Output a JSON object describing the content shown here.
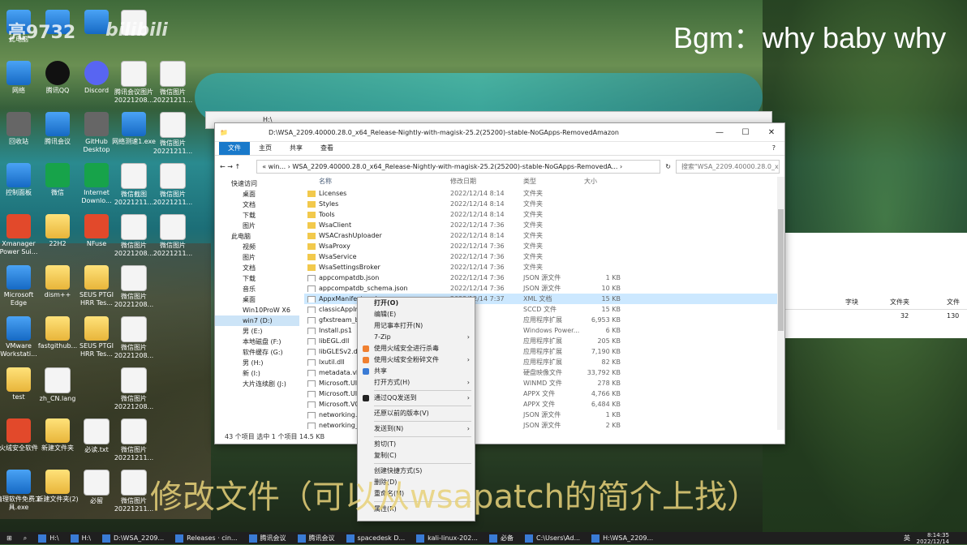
{
  "overlay": {
    "watermark": "亮9732",
    "bili": "bilibili",
    "bgm": "Bgm：why baby why",
    "subtitle": "修改文件（可以从wsapatch的简介上找）"
  },
  "desktop_icons": [
    {
      "label": "此电脑",
      "kind": "blue"
    },
    {
      "label": "",
      "kind": "blue"
    },
    {
      "label": "",
      "kind": "blue"
    },
    {
      "label": "",
      "kind": "doc"
    },
    {
      "label": "网络",
      "kind": "blue"
    },
    {
      "label": "腾讯QQ",
      "kind": "qq"
    },
    {
      "label": "Discord",
      "kind": "discord"
    },
    {
      "label": "腾讯会议图片20221208...",
      "kind": "doc"
    },
    {
      "label": "微信图片20221211...",
      "kind": "doc"
    },
    {
      "label": "回收站",
      "kind": "gray"
    },
    {
      "label": "腾讯会议",
      "kind": "blue"
    },
    {
      "label": "GitHub Desktop",
      "kind": "gray"
    },
    {
      "label": "网络测速1.exe",
      "kind": "blue"
    },
    {
      "label": "微信图片20221211...",
      "kind": "doc"
    },
    {
      "label": "控制面板",
      "kind": "blue"
    },
    {
      "label": "微信",
      "kind": "green"
    },
    {
      "label": "Internet Downlo...",
      "kind": "green"
    },
    {
      "label": "微信截图20221211...",
      "kind": "doc"
    },
    {
      "label": "微信图片20221211...",
      "kind": "doc"
    },
    {
      "label": "Xmanager Power Sui...",
      "kind": "red"
    },
    {
      "label": "22H2",
      "kind": "folder"
    },
    {
      "label": "NFuse",
      "kind": "red"
    },
    {
      "label": "微信图片20221208...",
      "kind": "doc"
    },
    {
      "label": "微信图片20221211...",
      "kind": "doc"
    },
    {
      "label": "Microsoft Edge",
      "kind": "blue"
    },
    {
      "label": "dism++",
      "kind": "folder"
    },
    {
      "label": "SEUS PTGI HRR Tes...",
      "kind": "folder"
    },
    {
      "label": "微信图片20221208...",
      "kind": "doc"
    },
    {
      "label": "VMware Workstati...",
      "kind": "blue"
    },
    {
      "label": "fastgithub...",
      "kind": "folder"
    },
    {
      "label": "SEUS PTGI HRR Tes...",
      "kind": "folder"
    },
    {
      "label": "微信图片20221208...",
      "kind": "doc"
    },
    {
      "label": "test",
      "kind": "folder"
    },
    {
      "label": "zh_CN.lang",
      "kind": "doc"
    },
    {
      "label": "微信图片20221208...",
      "kind": "doc"
    },
    {
      "label": "火绒安全软件",
      "kind": "red"
    },
    {
      "label": "新建文件夹",
      "kind": "folder"
    },
    {
      "label": "必读.txt",
      "kind": "doc"
    },
    {
      "label": "微信图片20221211...",
      "kind": "doc"
    },
    {
      "label": "清理软件免费工具.exe",
      "kind": "blue"
    },
    {
      "label": "新建文件夹(2)",
      "kind": "folder"
    },
    {
      "label": "必留",
      "kind": "doc"
    },
    {
      "label": "微信图片20221211...",
      "kind": "doc"
    }
  ],
  "back_window": {
    "title": "H:\\"
  },
  "right_panel": {
    "headers": [
      "字块",
      "文件夹",
      "文件"
    ],
    "values": [
      "",
      "32",
      "130"
    ]
  },
  "explorer": {
    "title": "D:\\WSA_2209.40000.28.0_x64_Release-Nightly-with-magisk-25.2(25200)-stable-NoGApps-RemovedAmazon",
    "ribbon": [
      "文件",
      "主页",
      "共享",
      "查看"
    ],
    "address": "« win... › WSA_2209.40000.28.0_x64_Release-Nightly-with-magisk-25.2(25200)-stable-NoGApps-RemovedA... ›",
    "search": "搜索\"WSA_2209.40000.28.0_x...",
    "nav": [
      {
        "label": "快速访问",
        "sec": true
      },
      {
        "label": "桌面"
      },
      {
        "label": "文档"
      },
      {
        "label": "下载"
      },
      {
        "label": "图片"
      },
      {
        "label": "此电脑",
        "sec": true
      },
      {
        "label": "视频"
      },
      {
        "label": "图片"
      },
      {
        "label": "文档"
      },
      {
        "label": "下载"
      },
      {
        "label": "音乐"
      },
      {
        "label": "桌面"
      },
      {
        "label": "Win10ProW X6"
      },
      {
        "label": "win7 (D:)",
        "sel": true
      },
      {
        "label": "男 (E:)"
      },
      {
        "label": "本地磁盘 (F:)"
      },
      {
        "label": "软件缓存 (G:)"
      },
      {
        "label": "男 (H:)"
      },
      {
        "label": "新 (I:)"
      },
      {
        "label": "大片连续剧 (J:)"
      }
    ],
    "columns": [
      "名称",
      "修改日期",
      "类型",
      "大小"
    ],
    "files": [
      {
        "name": "Licenses",
        "date": "2022/12/14 8:14",
        "type": "文件夹",
        "size": "",
        "folder": true
      },
      {
        "name": "Styles",
        "date": "2022/12/14 8:14",
        "type": "文件夹",
        "size": "",
        "folder": true
      },
      {
        "name": "Tools",
        "date": "2022/12/14 8:14",
        "type": "文件夹",
        "size": "",
        "folder": true
      },
      {
        "name": "WsaClient",
        "date": "2022/12/14 7:36",
        "type": "文件夹",
        "size": "",
        "folder": true
      },
      {
        "name": "WSACrashUploader",
        "date": "2022/12/14 8:14",
        "type": "文件夹",
        "size": "",
        "folder": true
      },
      {
        "name": "WsaProxy",
        "date": "2022/12/14 7:36",
        "type": "文件夹",
        "size": "",
        "folder": true
      },
      {
        "name": "WsaService",
        "date": "2022/12/14 7:36",
        "type": "文件夹",
        "size": "",
        "folder": true
      },
      {
        "name": "WsaSettingsBroker",
        "date": "2022/12/14 7:36",
        "type": "文件夹",
        "size": "",
        "folder": true
      },
      {
        "name": "appcompatdb.json",
        "date": "2022/12/14 7:36",
        "type": "JSON 源文件",
        "size": "1 KB"
      },
      {
        "name": "appcompatdb_schema.json",
        "date": "2022/12/14 7:36",
        "type": "JSON 源文件",
        "size": "10 KB"
      },
      {
        "name": "AppxManifest.xml",
        "date": "2022/12/14 7:37",
        "type": "XML 文档",
        "size": "15 KB",
        "sel": true
      },
      {
        "name": "classicAppIns",
        "date": "",
        "type": "SCCD 文件",
        "size": "15 KB"
      },
      {
        "name": "gfxstream_ba",
        "date": "",
        "type": "应用程序扩展",
        "size": "6,953 KB"
      },
      {
        "name": "Install.ps1",
        "date": "",
        "type": "Windows Power...",
        "size": "6 KB"
      },
      {
        "name": "libEGL.dll",
        "date": "",
        "type": "应用程序扩展",
        "size": "205 KB"
      },
      {
        "name": "libGLESv2.dll",
        "date": "",
        "type": "应用程序扩展",
        "size": "7,190 KB"
      },
      {
        "name": "lxutil.dll",
        "date": "",
        "type": "应用程序扩展",
        "size": "82 KB"
      },
      {
        "name": "metadata.vhc",
        "date": "",
        "type": "硬盘映像文件",
        "size": "33,792 KB"
      },
      {
        "name": "Microsoft.UI.",
        "date": "",
        "type": "WINMD 文件",
        "size": "278 KB"
      },
      {
        "name": "Microsoft.UI.",
        "date": "",
        "type": "APPX 文件",
        "size": "4,766 KB"
      },
      {
        "name": "Microsoft.VC",
        "date": "",
        "type": "APPX 文件",
        "size": "6,484 KB"
      },
      {
        "name": "networking.js",
        "date": "",
        "type": "JSON 源文件",
        "size": "1 KB"
      },
      {
        "name": "networking_s",
        "date": "",
        "type": "JSON 源文件",
        "size": "2 KB"
      }
    ],
    "status": "43 个项目    选中 1 个项目  14.5 KB"
  },
  "context_menu": [
    {
      "label": "打开(O)",
      "bold": true
    },
    {
      "label": "编辑(E)"
    },
    {
      "label": "用记事本打开(N)"
    },
    {
      "label": "7-Zip",
      "sub": true
    },
    {
      "label": "使用火绒安全进行杀毒",
      "icon": "#f08030"
    },
    {
      "label": "使用火绒安全粉碎文件",
      "icon": "#f08030",
      "sub": true
    },
    {
      "label": "共享",
      "icon": "#3a7bd5"
    },
    {
      "label": "打开方式(H)",
      "sub": true
    },
    {
      "sep": true
    },
    {
      "label": "通过QQ发送到",
      "icon": "#222",
      "sub": true
    },
    {
      "sep": true
    },
    {
      "label": "还原以前的版本(V)"
    },
    {
      "sep": true
    },
    {
      "label": "发送到(N)",
      "sub": true
    },
    {
      "sep": true
    },
    {
      "label": "剪切(T)"
    },
    {
      "label": "复制(C)"
    },
    {
      "sep": true
    },
    {
      "label": "创建快捷方式(S)"
    },
    {
      "label": "删除(D)"
    },
    {
      "label": "重命名(M)"
    },
    {
      "sep": true
    },
    {
      "label": "属性(R)"
    }
  ],
  "taskbar": [
    "H:\\",
    "H:\\",
    "D:\\WSA_2209...",
    "",
    "Releases · cin...",
    "腾讯会议",
    "腾讯会议",
    "spacedesk D...",
    "kali-linux-202...",
    "必备",
    "C:\\Users\\Ad...",
    "H:\\WSA_2209..."
  ],
  "clock": {
    "time": "8:14:35",
    "date": "2022/12/14",
    "ime": "英"
  }
}
